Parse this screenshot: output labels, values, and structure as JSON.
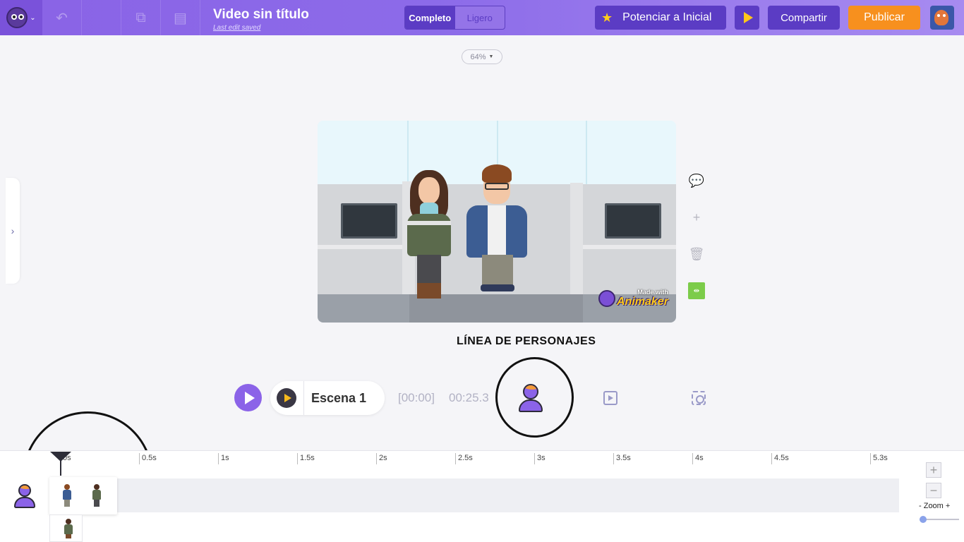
{
  "header": {
    "title": "Video sin título",
    "subtitle": "Last edit saved",
    "mode_toggle": {
      "active": "Completo",
      "inactive": "Ligero"
    },
    "upgrade_label": "Potenciar a Inicial",
    "share_label": "Compartir",
    "publish_label": "Publicar"
  },
  "toolbar": {
    "icons": [
      "undo-icon",
      "copy-icon",
      "paste-icon"
    ]
  },
  "workspace": {
    "zoom": "64%",
    "watermark_small": "Made with",
    "watermark_big": "Animaker",
    "side_tools": [
      "comment-icon",
      "add-icon",
      "delete-icon",
      "fit-icon"
    ]
  },
  "annotation": "LÍNEA DE PERSONAJES",
  "playback": {
    "scene_label": "Escena 1",
    "current_time": "[00:00]",
    "total_time": "00:25.3"
  },
  "timeline": {
    "ticks": [
      "0s",
      "0.5s",
      "1s",
      "1.5s",
      "2s",
      "2.5s",
      "3s",
      "3.5s",
      "4s",
      "4.5s",
      "5.3s"
    ],
    "zoom_label": "- Zoom +",
    "zoom_level": 0.05
  },
  "colors": {
    "accent": "#8b63e8",
    "dark_purple": "#5b3cc4",
    "publish": "#f7901e",
    "star": "#ffcc1a"
  }
}
